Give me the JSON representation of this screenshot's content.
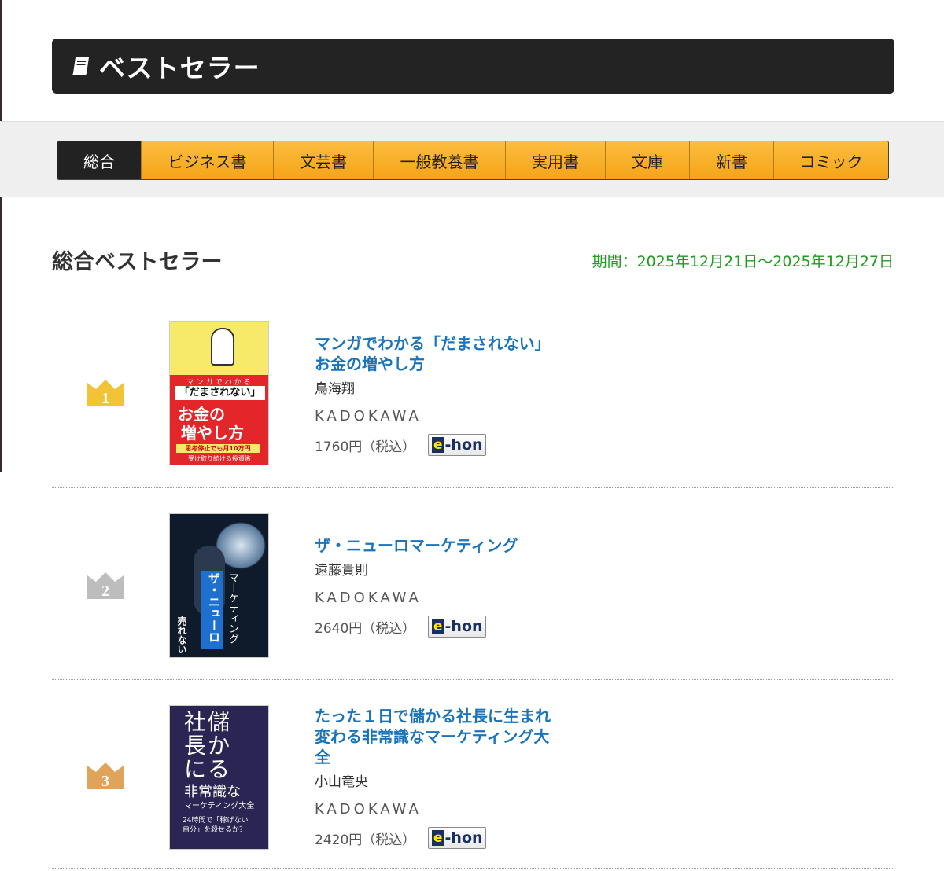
{
  "header": {
    "title": "ベストセラー",
    "icon": "book-icon"
  },
  "tabs": [
    {
      "label": "総合",
      "active": true
    },
    {
      "label": "ビジネス書",
      "active": false
    },
    {
      "label": "文芸書",
      "active": false
    },
    {
      "label": "一般教養書",
      "active": false
    },
    {
      "label": "実用書",
      "active": false
    },
    {
      "label": "文庫",
      "active": false
    },
    {
      "label": "新書",
      "active": false
    },
    {
      "label": "コミック",
      "active": false
    }
  ],
  "section": {
    "title": "総合ベストセラー",
    "period": "期間：2025年12月21日〜2025年12月27日"
  },
  "colors": {
    "gold": "#f2c237",
    "silver": "#bdbdbd",
    "bronze": "#e0a35a",
    "link": "#1b74bb",
    "period": "#1e9c1e"
  },
  "books": [
    {
      "rank": "1",
      "title_lines": [
        "マンガでわかる「だまされない」",
        "お金の増やし方"
      ],
      "author": "鳥海翔",
      "publisher": "KADOKAWA",
      "price": "1760円（税込）",
      "ehon": {
        "e": "e",
        "rest": "-hon"
      },
      "cover": {
        "top": [
          "マンガでわかる"
        ],
        "main": [
          "「だまされない」",
          "お金の",
          "増やし方"
        ],
        "banner": "思考停止でも月10万円",
        "bottom": "受け取り続ける投資術"
      }
    },
    {
      "rank": "2",
      "title_lines": [
        "ザ・ニューロマーケティング"
      ],
      "author": "遠藤貴則",
      "publisher": "KADOKAWA",
      "price": "2640円（税込）",
      "ehon": {
        "e": "e",
        "rest": "-hon"
      },
      "cover": {
        "main": [
          "ザ・ニューロ",
          "マーケティング"
        ],
        "side": "売れない"
      }
    },
    {
      "rank": "3",
      "title_lines": [
        "たった１日で儲かる社長に生まれ",
        "変わる非常識なマーケティング大",
        "全"
      ],
      "author": "小山竜央",
      "publisher": "KADOKAWA",
      "price": "2420円（税込）",
      "ehon": {
        "e": "e",
        "rest": "-hon"
      },
      "cover": {
        "main": [
          "社儲",
          "長か",
          "にる"
        ],
        "sub": [
          "非常識な",
          "マーケティング大全"
        ],
        "bottom": "24時間で「稼げない自分」を殺せるか？"
      }
    }
  ]
}
